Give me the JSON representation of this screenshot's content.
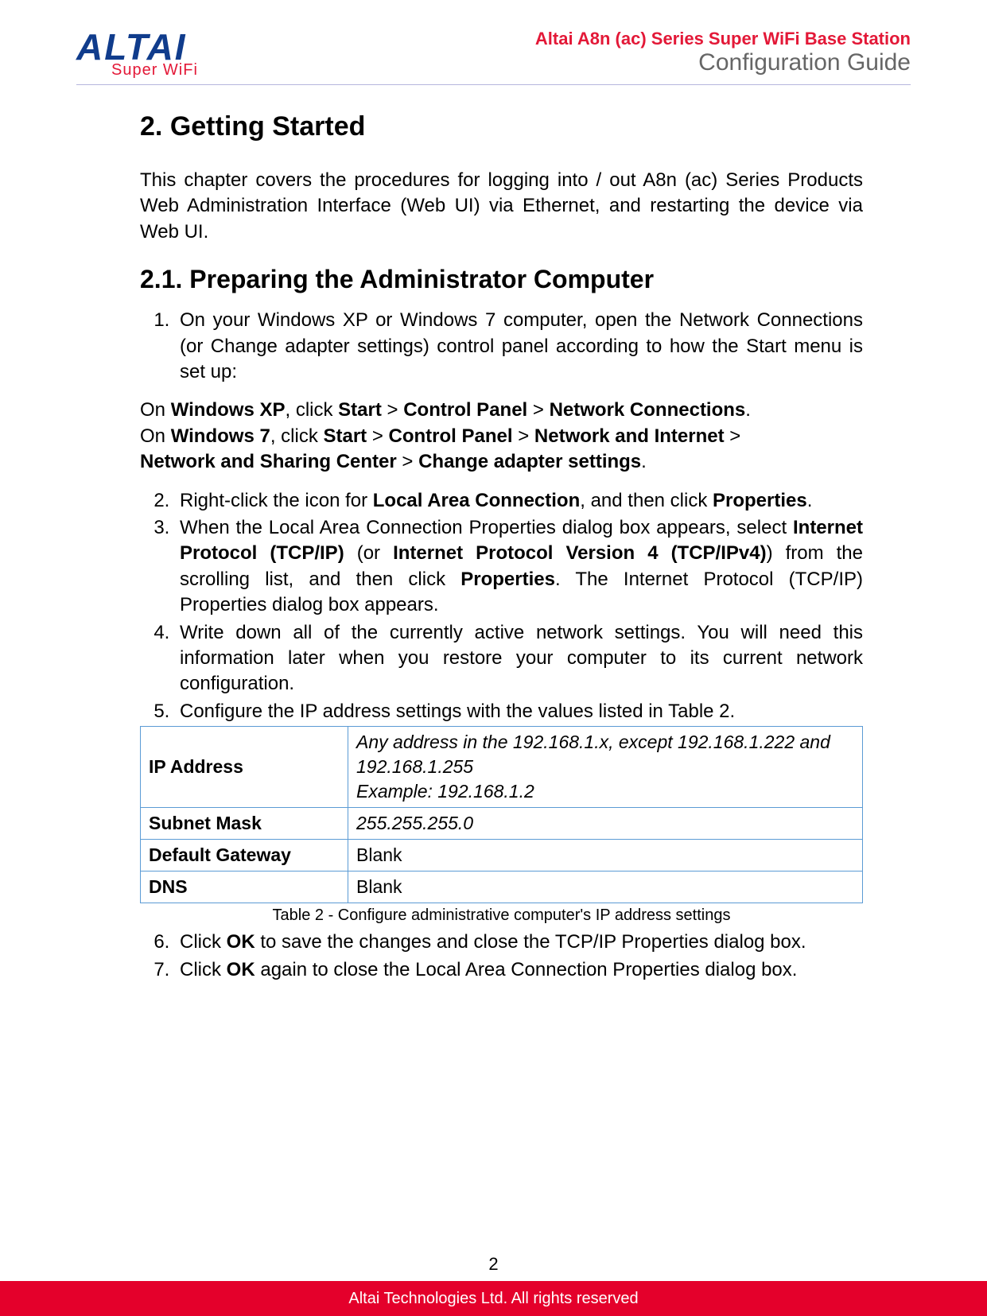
{
  "header": {
    "logo_main": "ALTAI",
    "logo_sub": "Super WiFi",
    "product_line": "Altai A8n (ac) Series Super WiFi Base Station",
    "guide_line": "Configuration Guide"
  },
  "section": {
    "num": "2.",
    "title": "Getting Started",
    "intro": "This chapter covers the procedures for logging into / out A8n (ac) Series Products Web Administration Interface (Web UI) via Ethernet, and restarting the device via Web UI.",
    "sub_num": "2.1.",
    "sub_title": "Preparing the Administrator Computer"
  },
  "steps": {
    "s1": "On your Windows XP or Windows 7 computer, open the Network Connections (or Change adapter settings) control panel according to how the Start menu is set up:",
    "nav_xp_pre": "On ",
    "nav_xp_os": "Windows XP",
    "nav_xp_mid": ", click ",
    "nav_xp_p1": "Start",
    "nav_xp_p2": "Control Panel",
    "nav_xp_p3": "Network Connections",
    "nav7_pre": "On ",
    "nav7_os": "Windows 7",
    "nav7_mid": ", click ",
    "nav7_p1": "Start",
    "nav7_p2": "Control Panel",
    "nav7_p3": "Network and Internet",
    "nav7_p4": "Network and Sharing Center",
    "nav7_p5": "Change adapter settings",
    "s2_a": "Right-click the icon for ",
    "s2_b": "Local Area Connection",
    "s2_c": ", and then click ",
    "s2_d": "Properties",
    "s2_e": ".",
    "s3_a": "When the Local Area Connection Properties dialog box appears, select ",
    "s3_b": "Internet Protocol (TCP/IP)",
    "s3_c": " (or ",
    "s3_d": "Internet Protocol Version 4 (TCP/IPv4)",
    "s3_e": ") from the scrolling list, and then click ",
    "s3_f": "Properties",
    "s3_g": ". The Internet Protocol (TCP/IP) Properties dialog box appears.",
    "s4": "Write down all of the currently active network settings. You will need this information later when you restore your computer to its current network configuration.",
    "s5": "Configure the IP address settings with the values listed in Table 2.",
    "s6_a": "Click ",
    "s6_b": "OK",
    "s6_c": " to save the changes and close the TCP/IP Properties dialog box.",
    "s7_a": "Click ",
    "s7_b": "OK",
    "s7_c": " again to close the Local Area Connection Properties dialog box."
  },
  "table": {
    "rows": [
      {
        "k": "IP Address",
        "v": "Any address in the 192.168.1.x, except 192.168.1.222 and 192.168.1.255\nExample: 192.168.1.2",
        "italic": true
      },
      {
        "k": "Subnet Mask",
        "v": "255.255.255.0",
        "italic": true
      },
      {
        "k": "Default Gateway",
        "v": "Blank",
        "italic": false
      },
      {
        "k": "DNS",
        "v": "Blank",
        "italic": false
      }
    ],
    "caption": "Table 2 - Configure administrative computer's IP address settings"
  },
  "footer": {
    "page_num": "2",
    "copyright": "Altai Technologies Ltd. All rights reserved"
  },
  "sep": " > ",
  "dot": "."
}
